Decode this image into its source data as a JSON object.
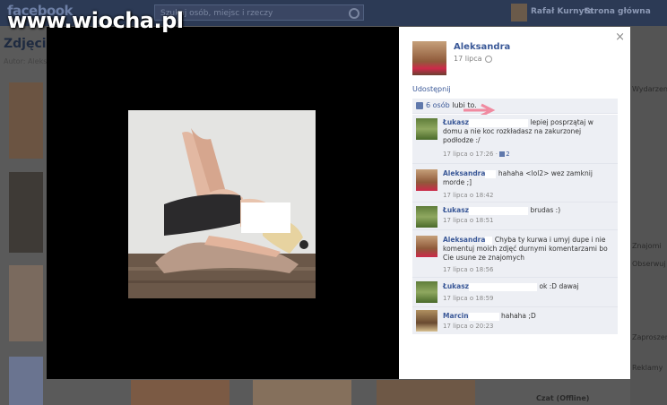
{
  "watermark": "www.wiocha.pl",
  "background": {
    "logo": "facebook",
    "search_placeholder": "Szukaj osób, miejsc i rzeczy",
    "user_name": "Rafał Kurnyta",
    "home_link": "Strona główna",
    "page_title": "Zdjęcia",
    "page_sub": "Autor: Aleks",
    "right_items": [
      "Wydarzenia",
      "Znajomi",
      "Obserwuj",
      "Zaproszenia",
      "Reklamy"
    ],
    "chat_label": "Czat (Offline)"
  },
  "post": {
    "author": "Aleksandra",
    "date": "17 lipca",
    "share_label": "Udostępnij",
    "likes_count": "6 osób",
    "likes_suffix": "lubi to.",
    "close_glyph": "×"
  },
  "comments": [
    {
      "name": "Łukasz",
      "text": "lepiej posprzątaj w domu a nie koc rozkładasz na zakurzonej podłodze :/",
      "time": "17 lipca o 17:26",
      "like_count": "2"
    },
    {
      "name": "Aleksandra",
      "text": "hahaha <lol2> wez zamknij morde ;]",
      "time": "17 lipca o 18:42",
      "like_count": ""
    },
    {
      "name": "Łukasz",
      "text": "brudas :)",
      "time": "17 lipca o 18:51",
      "like_count": ""
    },
    {
      "name": "Aleksandra",
      "text": "Chyba ty kurwa i umyj dupe i nie komentuj moich zdjęć durnymi komentarzami bo Cie usune ze znajomych",
      "time": "17 lipca o 18:56",
      "like_count": ""
    },
    {
      "name": "Łukasz",
      "text": "ok :D dawaj",
      "time": "17 lipca o 18:59",
      "like_count": ""
    },
    {
      "name": "Marcin",
      "text": "hahaha ;D",
      "time": "17 lipca o 20:23",
      "like_count": ""
    }
  ],
  "colors": {
    "link": "#3b5998",
    "comment_bg": "#edeff4",
    "lightbox_bg": "#000000"
  },
  "icons": [
    "close-icon",
    "globe-icon",
    "like-thumb-icon",
    "search-icon"
  ]
}
